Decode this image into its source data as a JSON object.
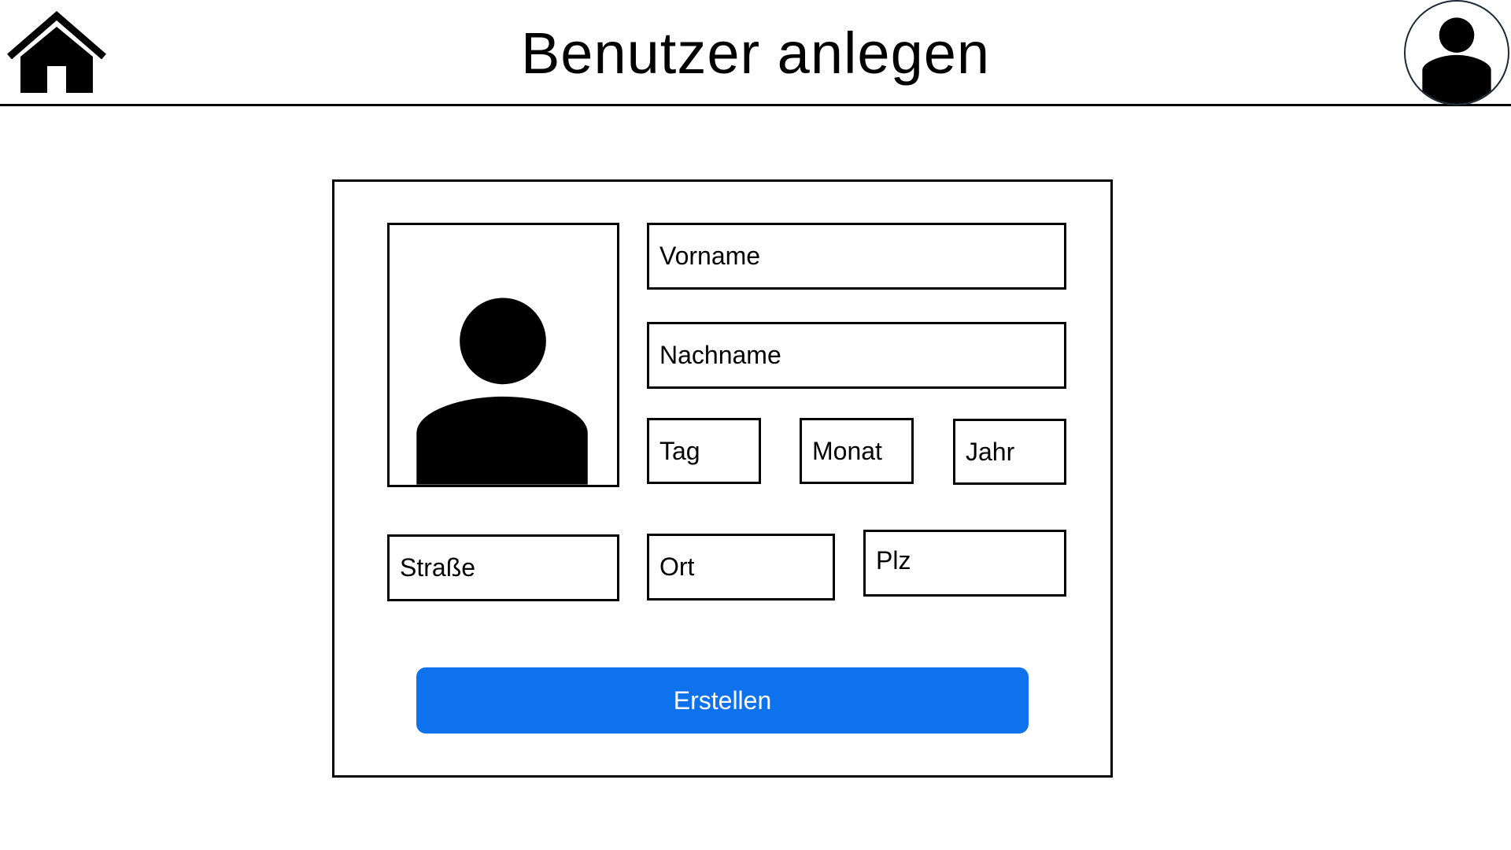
{
  "header": {
    "title": "Benutzer anlegen",
    "home_icon": "home-icon",
    "profile_icon": "user-avatar-icon"
  },
  "form": {
    "photo_icon": "user-silhouette-icon",
    "fields": {
      "vorname": {
        "placeholder": "Vorname",
        "value": ""
      },
      "nachname": {
        "placeholder": "Nachname",
        "value": ""
      },
      "tag": {
        "placeholder": "Tag",
        "value": ""
      },
      "monat": {
        "placeholder": "Monat",
        "value": ""
      },
      "jahr": {
        "placeholder": "Jahr",
        "value": ""
      },
      "strasse": {
        "placeholder": "Straße",
        "value": ""
      },
      "ort": {
        "placeholder": "Ort",
        "value": ""
      },
      "plz": {
        "placeholder": "Plz",
        "value": ""
      }
    },
    "submit_label": "Erstellen"
  },
  "colors": {
    "primary": "#0e72ed",
    "text": "#000000",
    "background": "#ffffff",
    "avatar_border": "#1b2a36"
  }
}
